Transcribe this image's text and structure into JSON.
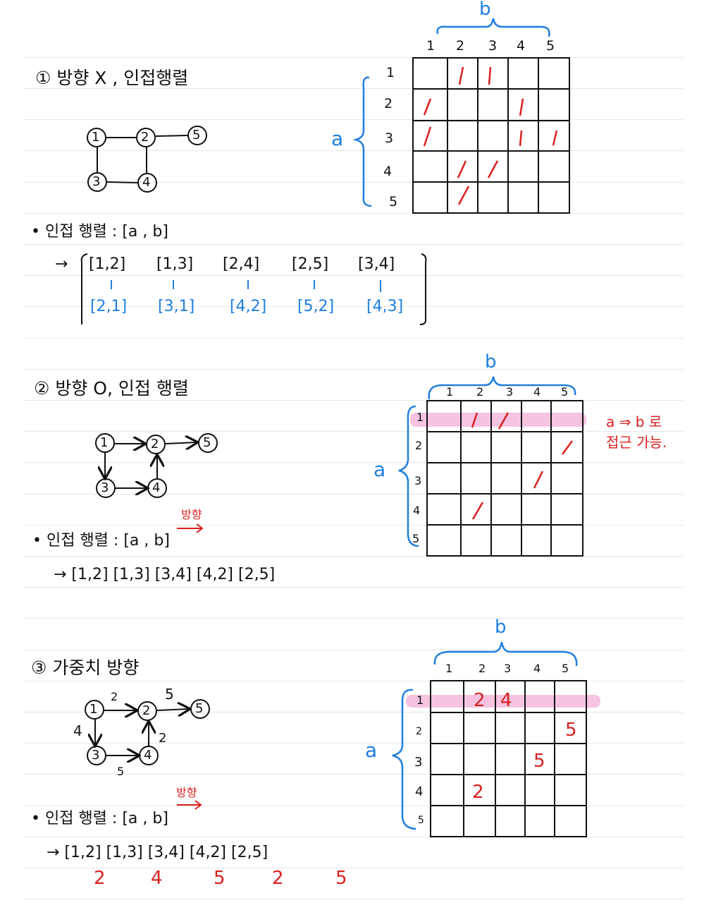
{
  "section1": {
    "title": "① 방향 X , 인접행렬",
    "graph_nodes": [
      "1",
      "2",
      "3",
      "4",
      "5"
    ],
    "matrix": {
      "axis_top": "b",
      "axis_side": "a",
      "col_labels": [
        "1",
        "2",
        "3",
        "4",
        "5"
      ],
      "row_labels": [
        "1",
        "2",
        "3",
        "4",
        "5"
      ],
      "mark": "/"
    },
    "bullet": "• 인접 행렬 : [a , b]",
    "pairs_label": "→",
    "pairs": [
      "[1,2]",
      "[1,3]",
      "[2,4]",
      "[2,5]",
      "[3,4]"
    ],
    "reverse_pairs": [
      "[2,1]",
      "[3,1]",
      "[4,2]",
      "[5,2]",
      "[4,3]"
    ]
  },
  "section2": {
    "title": "② 방향 O, 인접 행렬",
    "graph_nodes": [
      "1",
      "2",
      "3",
      "4",
      "5"
    ],
    "matrix": {
      "axis_top": "b",
      "axis_side": "a",
      "col_labels": [
        "1",
        "2",
        "3",
        "4",
        "5"
      ],
      "row_labels": [
        "1",
        "2",
        "3",
        "4",
        "5"
      ],
      "mark": "/"
    },
    "note": "a ⇒ b 로\n접근 가능.",
    "direction_label": "방향",
    "bullet": "• 인접 행렬 : [a , b]",
    "pairs_line": "→ [1,2] [1,3] [3,4] [4,2] [2,5]"
  },
  "section3": {
    "title": "③ 가중치 방향",
    "graph_nodes": [
      "1",
      "2",
      "3",
      "4",
      "5"
    ],
    "edge_weights": {
      "1-2": "2",
      "2-5": "5",
      "1-3": "4",
      "4-2": "2",
      "3-4": "5"
    },
    "matrix": {
      "axis_top": "b",
      "axis_side": "a",
      "col_labels": [
        "1",
        "2",
        "3",
        "4",
        "5"
      ],
      "row_labels": [
        "1",
        "2",
        "3",
        "4",
        "5"
      ],
      "cells": {
        "r1c2": "2",
        "r1c3": "4",
        "r2c5": "5",
        "r3c4": "5",
        "r4c2": "2"
      }
    },
    "direction_label": "방향",
    "bullet": "• 인접 행렬 : [a , b]",
    "pairs_line": "→ [1,2] [1,3] [3,4] [4,2] [2,5]",
    "weights": [
      "2",
      "4",
      "5",
      "2",
      "5"
    ]
  },
  "colors": {
    "ink": "#111111",
    "blue": "#1f7fe0",
    "red": "#d8201e",
    "highlight": "#f5b9dc",
    "rule": "#e6e6e6"
  }
}
